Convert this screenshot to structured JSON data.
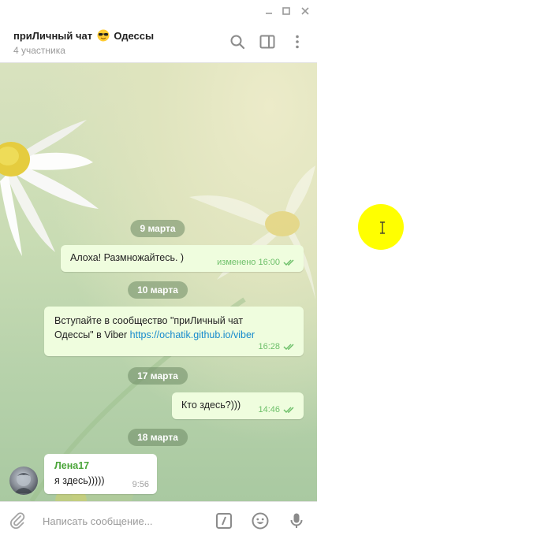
{
  "window": {
    "controls": {
      "minimize": "–",
      "maximize": "□",
      "close": "×"
    }
  },
  "header": {
    "title_before": "приЛичный чат",
    "title_emoji": "sunglasses-emoji",
    "title_after": "Одессы",
    "subtitle": "4 участника",
    "icons": [
      "search-icon",
      "sidebar-toggle-icon",
      "more-vert-icon"
    ]
  },
  "messages": [
    {
      "date": "9 марта"
    },
    {
      "text": "Алоха! Размножайтесь. )",
      "meta": "изменено 16:00",
      "status": "read"
    },
    {
      "date": "10 марта"
    },
    {
      "text_line1": "Вступайте в сообщество  \"приЛичный чат",
      "text_line2": "Одессы\" в Viber ",
      "link": "https://ochatik.github.io/viber",
      "meta": "16:28",
      "status": "read"
    },
    {
      "date": "17 марта"
    },
    {
      "text": "Кто здесь?)))",
      "meta": "14:46",
      "status": "read"
    },
    {
      "date": "18 марта"
    },
    {
      "sender": "Лена17",
      "text": "я здесь)))))",
      "meta": "9:56"
    }
  ],
  "composer": {
    "placeholder": "Написать сообщение...",
    "icons": [
      "attach-icon",
      "commands-icon",
      "emoji-icon",
      "microphone-icon"
    ]
  },
  "colors": {
    "outgoing_bubble": "#effdde",
    "incoming_bubble": "#ffffff",
    "checkmark": "#6ec06a",
    "link": "#168acd",
    "sender_name": "#4ba53a",
    "cursor_highlight": "#ffff00"
  }
}
